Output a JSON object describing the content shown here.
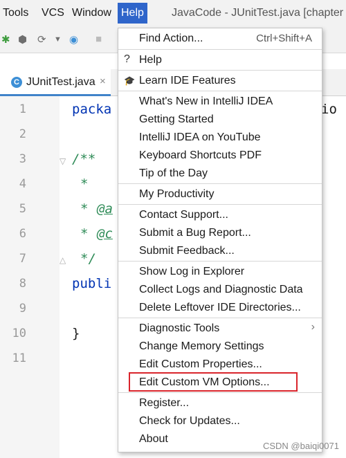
{
  "menubar": {
    "items": [
      "Tools",
      "VCS",
      "Window",
      "Help"
    ],
    "window_title": "JavaCode - JUnitTest.java [chapter"
  },
  "tab": {
    "label": "JUnitTest.java",
    "close": "×"
  },
  "editor": {
    "line_numbers": [
      "1",
      "2",
      "3",
      "4",
      "5",
      "6",
      "7",
      "8",
      "9",
      "10",
      "11"
    ],
    "line1": "packa",
    "line1_right": "io",
    "line3": "/**",
    "line4": "*",
    "line5_star": "*",
    "line5_tag": "@a",
    "line6_star": "*",
    "line6_tag": "@c",
    "line7": "*/",
    "line8": "publi",
    "line10": "}"
  },
  "help_menu": {
    "find_action": "Find Action...",
    "find_action_shortcut": "Ctrl+Shift+A",
    "help": "Help",
    "learn": "Learn IDE Features",
    "whats_new": "What's New in IntelliJ IDEA",
    "getting_started": "Getting Started",
    "youtube": "IntelliJ IDEA on YouTube",
    "keyboard_pdf": "Keyboard Shortcuts PDF",
    "tip": "Tip of the Day",
    "productivity": "My Productivity",
    "contact": "Contact Support...",
    "bug": "Submit a Bug Report...",
    "feedback": "Submit Feedback...",
    "show_log": "Show Log in Explorer",
    "collect_logs": "Collect Logs and Diagnostic Data",
    "delete_leftover": "Delete Leftover IDE Directories...",
    "diagnostic": "Diagnostic Tools",
    "memory": "Change Memory Settings",
    "custom_props": "Edit Custom Properties...",
    "custom_vm": "Edit Custom VM Options...",
    "register": "Register...",
    "updates": "Check for Updates...",
    "about": "About"
  },
  "watermark": "CSDN @baiqi0071",
  "colors": {
    "menu_active": "#2f65ca",
    "highlight_box": "#d9242b",
    "keyword": "#0033b3",
    "comment": "#2e8b57"
  }
}
